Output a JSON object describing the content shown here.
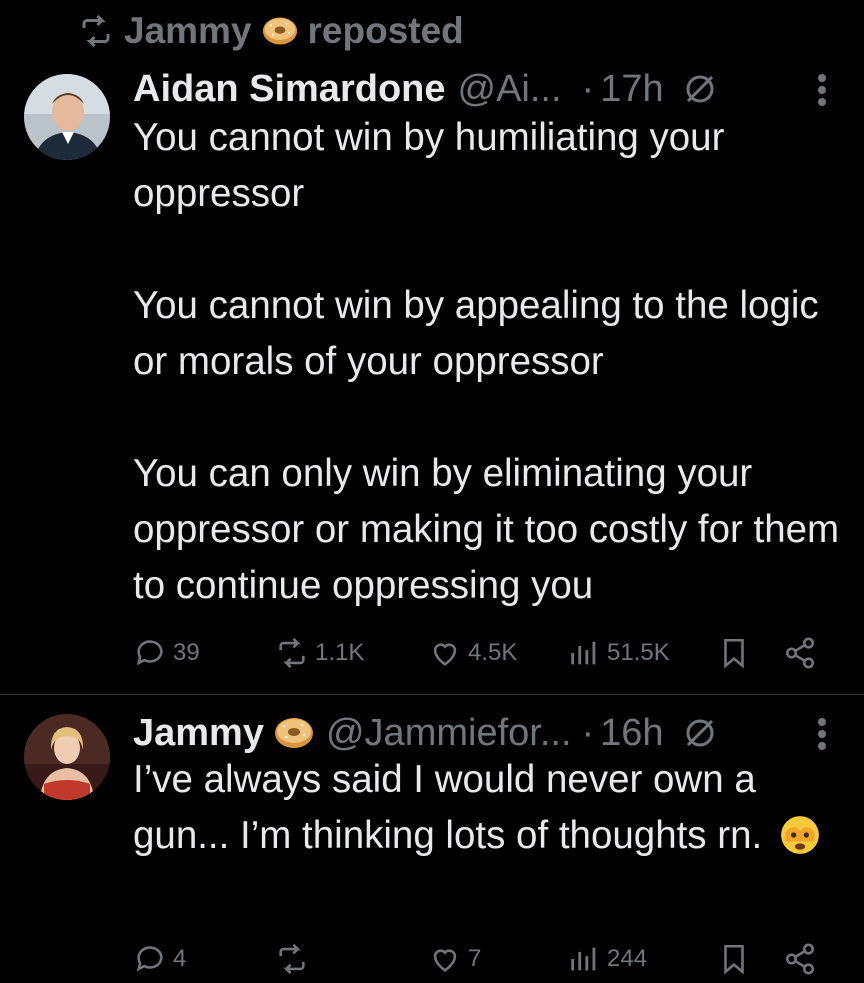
{
  "repost": {
    "user": "Jammy",
    "label": "reposted"
  },
  "tweets": [
    {
      "name": "Aidan Simardone",
      "handle": "@Ai...",
      "dot": "·",
      "time": "17h",
      "paragraphs": [
        "You cannot win by humiliating your oppressor",
        "You cannot win by appealing to the logic or morals of your oppressor",
        "You can only win by eliminating your oppressor or making it too costly for them to continue oppressing you"
      ],
      "stats": {
        "replies": "39",
        "reposts": "1.1K",
        "likes": "4.5K",
        "views": "51.5K"
      }
    },
    {
      "name": "Jammy",
      "handle": "@Jammiefor...",
      "dot": "·",
      "time": "16h",
      "text": "I’ve always said I would never own a gun... I’m thinking lots of thoughts rn.",
      "stats": {
        "replies": "4",
        "reposts": "",
        "likes": "7",
        "views": "244"
      }
    }
  ],
  "icons": {
    "repost": "repost-icon",
    "bagel": "bagel-emoji",
    "mute": "muted-icon",
    "more": "more-icon",
    "reply": "reply-icon",
    "like": "heart-icon",
    "views": "views-icon",
    "bookmark": "bookmark-icon",
    "share": "share-icon",
    "face_emoji": "face-with-peeking-eye-emoji"
  },
  "colors": {
    "background": "#000000",
    "text": "#e7e9ea",
    "secondary": "#71767b",
    "divider": "#2f3336"
  }
}
